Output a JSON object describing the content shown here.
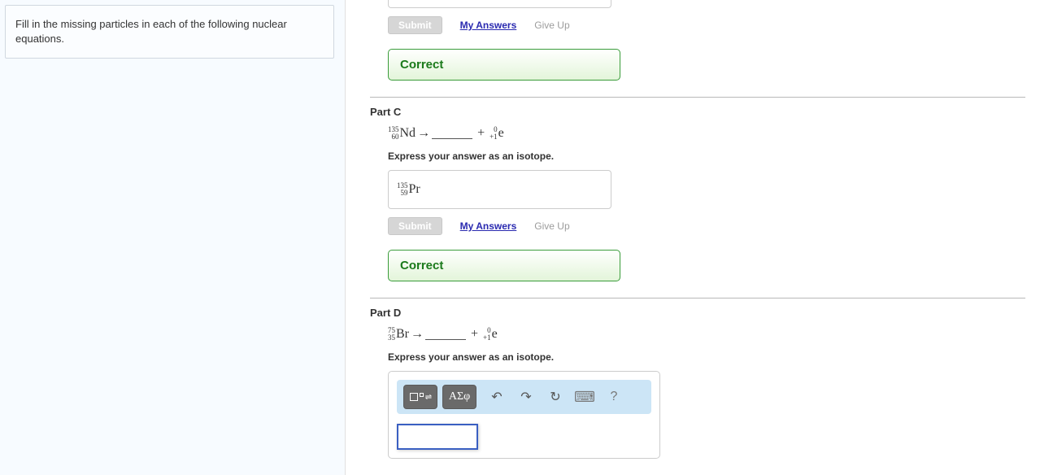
{
  "instructions": "Fill in the missing particles in each of the following nuclear equations.",
  "actions": {
    "submit": "Submit",
    "my_answers": "My Answers",
    "give_up": "Give Up"
  },
  "status": {
    "correct": "Correct"
  },
  "partB": {
    "status": "Correct"
  },
  "partC": {
    "title": "Part C",
    "eq": {
      "lhs_mass": "135",
      "lhs_atomic": "60",
      "lhs_sym": "Nd",
      "arrow": "→",
      "plus": "+",
      "rhs_mass": "0",
      "rhs_atomic": "+1",
      "rhs_sym": "e"
    },
    "instr": "Express your answer as an isotope.",
    "ans": {
      "mass": "135",
      "atomic": "59",
      "sym": "Pr"
    },
    "status": "Correct"
  },
  "partD": {
    "title": "Part D",
    "eq": {
      "lhs_mass": "75",
      "lhs_atomic": "35",
      "lhs_sym": "Br",
      "arrow": "→",
      "plus": "+",
      "rhs_mass": "0",
      "rhs_atomic": "+1",
      "rhs_sym": "e"
    },
    "instr": "Express your answer as an isotope.",
    "toolbar": {
      "greek": "ΑΣφ",
      "undo": "↶",
      "redo": "↷",
      "reset": "↻",
      "keyboard": "⌨",
      "help": "?"
    }
  }
}
